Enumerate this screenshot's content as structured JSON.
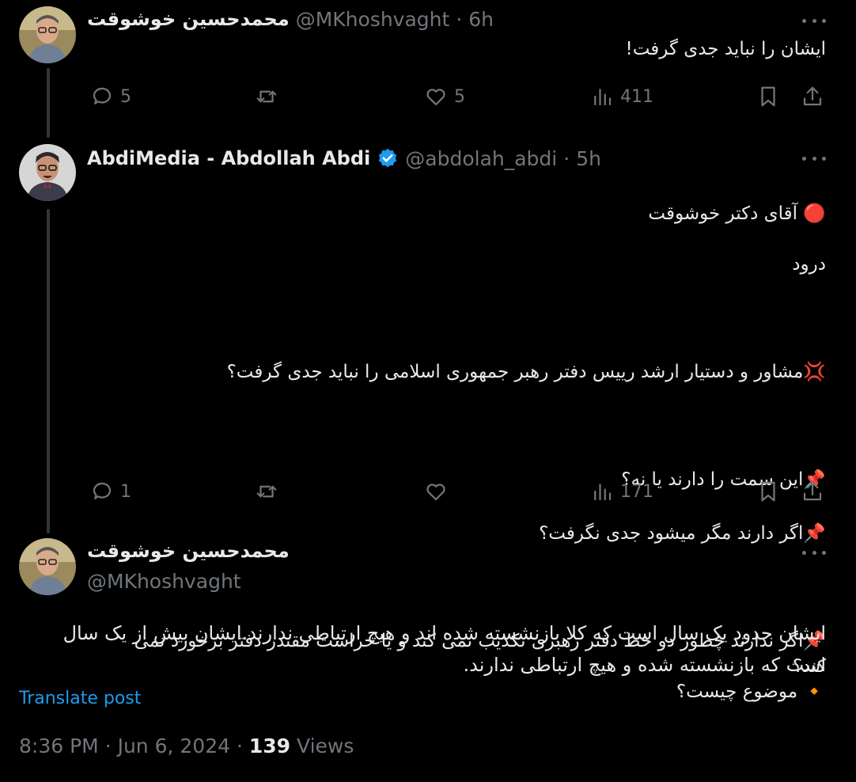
{
  "colors": {
    "background": "#000000",
    "text": "#e7e9ea",
    "muted": "#71767b",
    "link": "#1d9bf0",
    "verified": "#1d9bf0"
  },
  "tweet1": {
    "name": "محمدحسین خوشوقت",
    "handle": "@MKhoshvaght",
    "sep": "·",
    "time": "6h",
    "text": "ایشان را نباید جدی گرفت!",
    "actions": {
      "replies": "5",
      "retweets": "",
      "likes": "5",
      "views": "411"
    }
  },
  "tweet2": {
    "name": "AbdiMedia - Abdollah Abdi",
    "verified_icon": "verified-badge-icon",
    "handle": "@abdolah_abdi",
    "sep": "·",
    "time": "5h",
    "lines": [
      "🔴 آقای دکتر خوشوقت",
      "درود",
      "",
      "💢مشاور و دستیار ارشد رییس دفتر رهبر جمهوری اسلامی را نباید جدی گرفت؟",
      "",
      "📌این سمت را دارند یا نه؟",
      "📌اگر دارند مگر میشود جدی نگرفت؟",
      "",
      "📌اگر ندارند چطور دو خط دفتر رهبری تکذیب نمی کند و یا حراست مقتدر دفتر برخورد نمی کند؟",
      "🔸 موضوع چیست؟"
    ],
    "actions": {
      "replies": "1",
      "retweets": "",
      "likes": "",
      "views": "171"
    }
  },
  "tweet3": {
    "name": "محمدحسین خوشوقت",
    "handle": "@MKhoshvaght",
    "text": "ایشان حدود یک سال است که کلا بازنشسته شده اند و  هیچ ارتباطی ندارند.ایشان بیش از یک سال است که بازنشسته شده و  هیچ ارتباطی ندارند.",
    "translate": "Translate post",
    "time": "8:36 PM",
    "sep1": "·",
    "date": "Jun 6, 2024",
    "sep2": "·",
    "views_count": "139",
    "views_label": "Views"
  }
}
